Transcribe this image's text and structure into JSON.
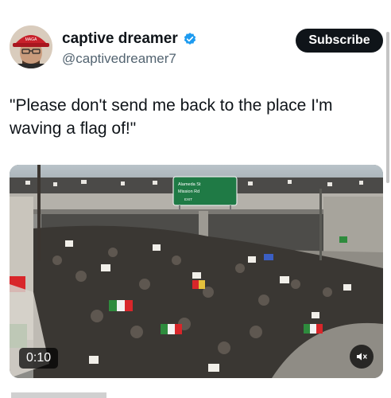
{
  "author": {
    "display_name": "captive dreamer",
    "handle": "@captivedreamer7",
    "avatar_icon": "profile-avatar-red-cap",
    "verified_icon": "verified-badge-icon",
    "verified_color": "#1d9bf0"
  },
  "actions": {
    "subscribe_label": "Subscribe"
  },
  "post": {
    "text": "\"Please don't send me back to the place I'm waving a flag of!\""
  },
  "media": {
    "duration": "0:10",
    "mute_icon": "speaker-muted-icon",
    "sign": {
      "line1": "Alameda St",
      "line2": "Mission Rd",
      "line3": "EXIT"
    }
  },
  "colors": {
    "subscribe_bg": "#0f1419",
    "sign_green": "#1f7a45",
    "flag_green": "#2e8b3d",
    "flag_red": "#d8262a"
  }
}
